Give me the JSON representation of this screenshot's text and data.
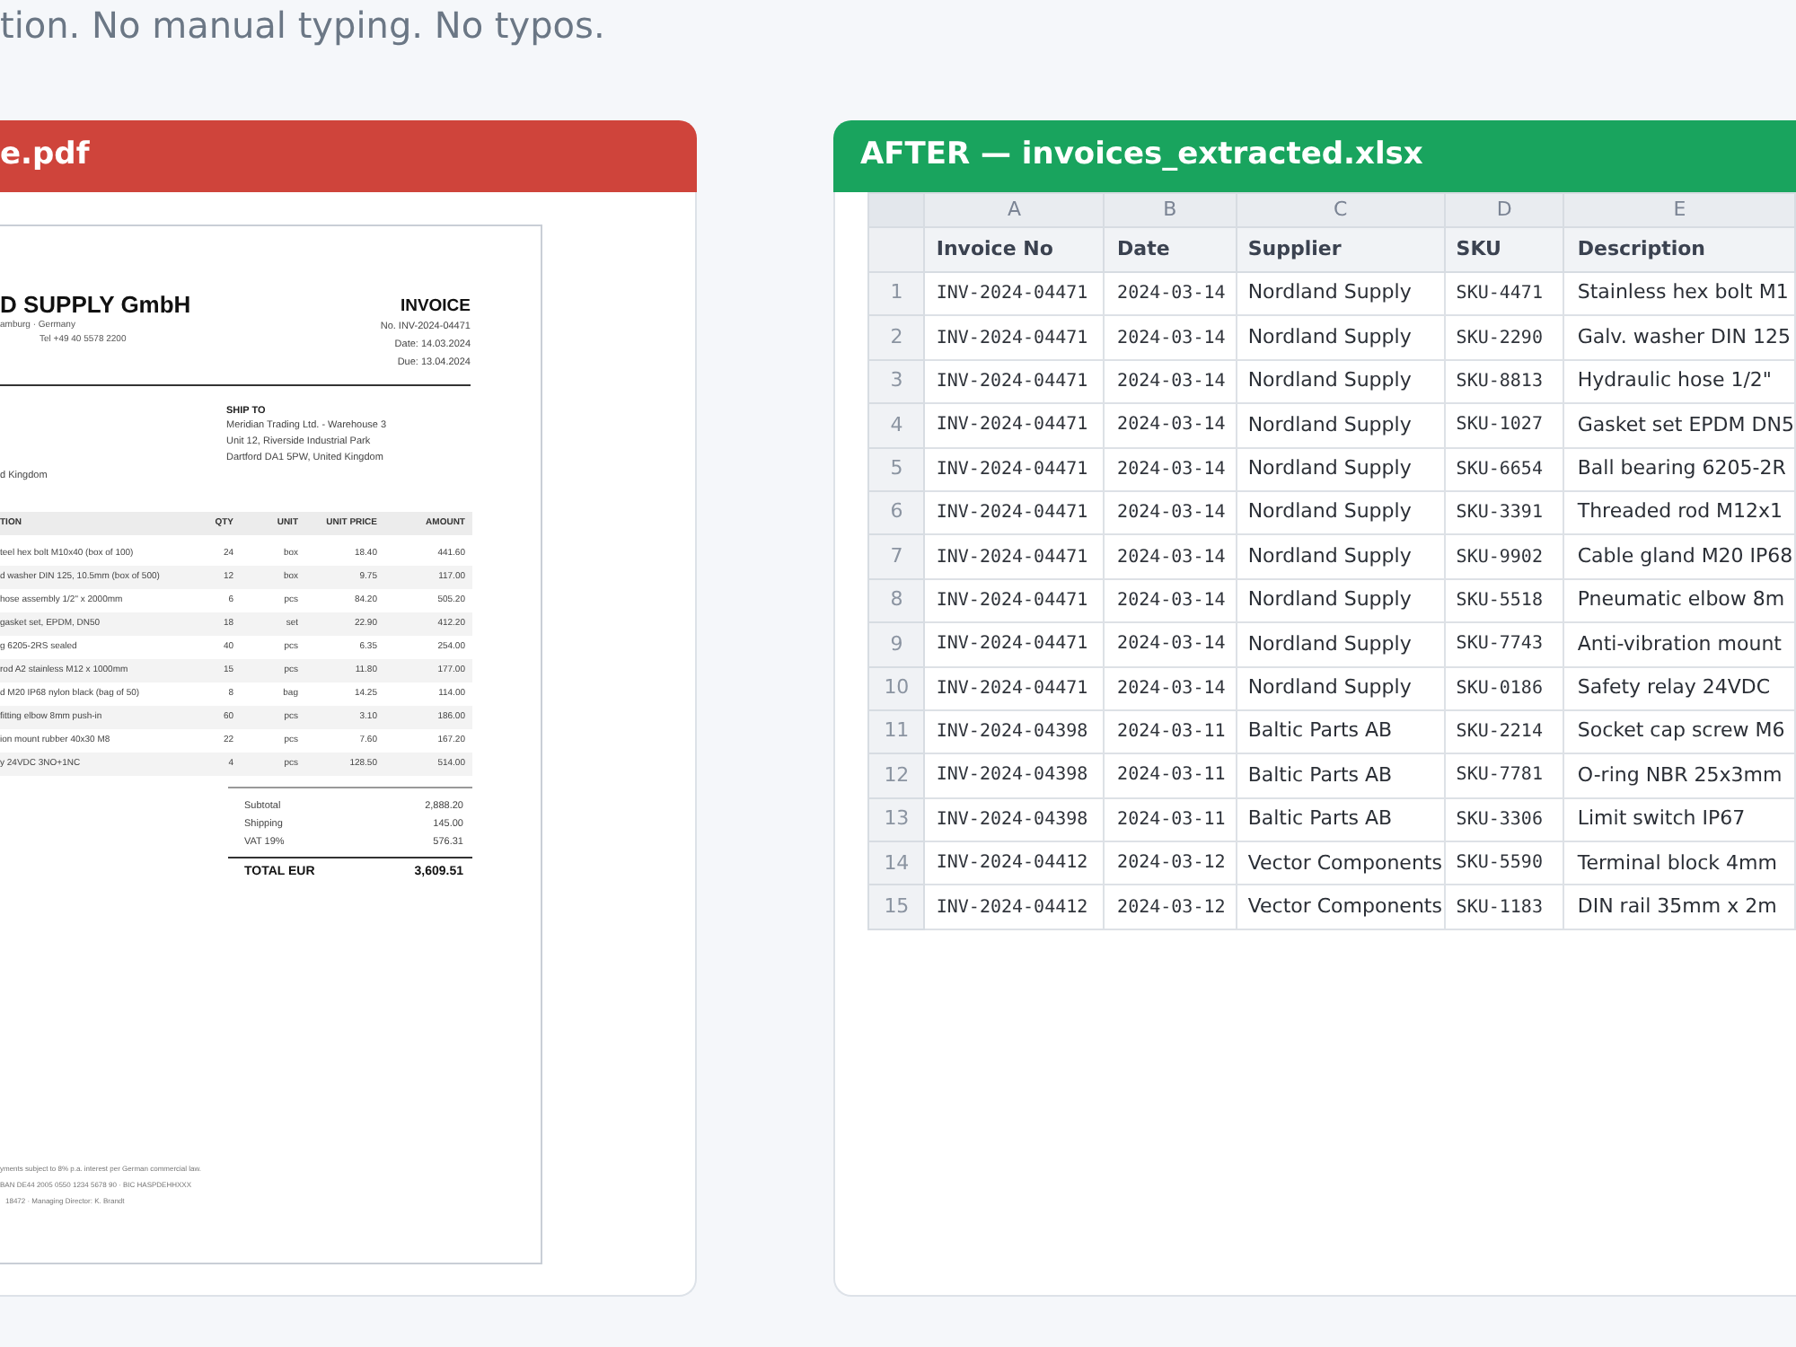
{
  "intro": {
    "text": "tion. No manual typing. No typos."
  },
  "before_panel": {
    "title": "e.pdf",
    "document": {
      "company": "D SUPPLY GmbH",
      "company_lines": [
        "amburg · Germany",
        "Tel +49 40 5578 2200"
      ],
      "doc_title": "INVOICE",
      "meta": [
        "No. INV-2024-04471",
        "Date: 14.03.2024",
        "Due: 13.04.2024"
      ],
      "bill_to_lines": [
        "d Kingdom"
      ],
      "ship_to": {
        "label": "SHIP TO",
        "lines": [
          "Meridian Trading Ltd. - Warehouse 3",
          "Unit 12, Riverside Industrial Park",
          "Dartford DA1 5PW, United Kingdom"
        ]
      },
      "item_columns": [
        "TION",
        "QTY",
        "UNIT",
        "UNIT PRICE",
        "AMOUNT"
      ],
      "items": [
        [
          "teel hex bolt M10x40 (box of 100)",
          "24",
          "box",
          "18.40",
          "441.60"
        ],
        [
          "d washer DIN 125, 10.5mm (box of 500)",
          "12",
          "box",
          "9.75",
          "117.00"
        ],
        [
          "hose assembly 1/2\" x 2000mm",
          "6",
          "pcs",
          "84.20",
          "505.20"
        ],
        [
          "gasket set, EPDM, DN50",
          "18",
          "set",
          "22.90",
          "412.20"
        ],
        [
          "g 6205-2RS sealed",
          "40",
          "pcs",
          "6.35",
          "254.00"
        ],
        [
          "rod A2 stainless M12 x 1000mm",
          "15",
          "pcs",
          "11.80",
          "177.00"
        ],
        [
          "d M20 IP68 nylon black (bag of 50)",
          "8",
          "bag",
          "14.25",
          "114.00"
        ],
        [
          "fitting elbow 8mm push-in",
          "60",
          "pcs",
          "3.10",
          "186.00"
        ],
        [
          "ion mount rubber 40x30 M8",
          "22",
          "pcs",
          "7.60",
          "167.20"
        ],
        [
          "y 24VDC 3NO+1NC",
          "4",
          "pcs",
          "128.50",
          "514.00"
        ]
      ],
      "totals": [
        {
          "label": "Subtotal",
          "value": "2,888.20"
        },
        {
          "label": "Shipping",
          "value": "145.00"
        },
        {
          "label": "VAT 19%",
          "value": "576.31"
        }
      ],
      "grand_total": {
        "label": "TOTAL EUR",
        "value": "3,609.51"
      },
      "footer": [
        "yments subject to 8% p.a. interest per German commercial law.",
        "BAN DE44 2005 0550 1234 5678 90 · BIC HASPDEHHXXX",
        "18472 · Managing Director: K. Brandt"
      ]
    }
  },
  "after_panel": {
    "title": "AFTER — invoices_extracted.xlsx",
    "sheet": {
      "columns": [
        {
          "letter": "A",
          "header": "Invoice No",
          "kind": "code"
        },
        {
          "letter": "B",
          "header": "Date",
          "kind": "code"
        },
        {
          "letter": "C",
          "header": "Supplier",
          "kind": "text"
        },
        {
          "letter": "D",
          "header": "SKU",
          "kind": "code"
        },
        {
          "letter": "E",
          "header": "Description",
          "kind": "text"
        }
      ],
      "rows": [
        {
          "number": "1",
          "cells": [
            "INV-2024-04471",
            "2024-03-14",
            "Nordland Supply",
            "SKU-4471",
            "Stainless hex bolt M1"
          ]
        },
        {
          "number": "2",
          "cells": [
            "INV-2024-04471",
            "2024-03-14",
            "Nordland Supply",
            "SKU-2290",
            "Galv. washer DIN 125"
          ]
        },
        {
          "number": "3",
          "cells": [
            "INV-2024-04471",
            "2024-03-14",
            "Nordland Supply",
            "SKU-8813",
            "Hydraulic hose 1/2\""
          ]
        },
        {
          "number": "4",
          "cells": [
            "INV-2024-04471",
            "2024-03-14",
            "Nordland Supply",
            "SKU-1027",
            "Gasket set EPDM DN5"
          ]
        },
        {
          "number": "5",
          "cells": [
            "INV-2024-04471",
            "2024-03-14",
            "Nordland Supply",
            "SKU-6654",
            "Ball bearing 6205-2R"
          ]
        },
        {
          "number": "6",
          "cells": [
            "INV-2024-04471",
            "2024-03-14",
            "Nordland Supply",
            "SKU-3391",
            "Threaded rod M12x1"
          ]
        },
        {
          "number": "7",
          "cells": [
            "INV-2024-04471",
            "2024-03-14",
            "Nordland Supply",
            "SKU-9902",
            "Cable gland M20 IP68"
          ]
        },
        {
          "number": "8",
          "cells": [
            "INV-2024-04471",
            "2024-03-14",
            "Nordland Supply",
            "SKU-5518",
            "Pneumatic elbow 8m"
          ]
        },
        {
          "number": "9",
          "cells": [
            "INV-2024-04471",
            "2024-03-14",
            "Nordland Supply",
            "SKU-7743",
            "Anti-vibration mount"
          ]
        },
        {
          "number": "10",
          "cells": [
            "INV-2024-04471",
            "2024-03-14",
            "Nordland Supply",
            "SKU-0186",
            "Safety relay 24VDC"
          ]
        },
        {
          "number": "11",
          "cells": [
            "INV-2024-04398",
            "2024-03-11",
            "Baltic Parts AB",
            "SKU-2214",
            "Socket cap screw M6"
          ]
        },
        {
          "number": "12",
          "cells": [
            "INV-2024-04398",
            "2024-03-11",
            "Baltic Parts AB",
            "SKU-7781",
            "O-ring NBR 25x3mm"
          ]
        },
        {
          "number": "13",
          "cells": [
            "INV-2024-04398",
            "2024-03-11",
            "Baltic Parts AB",
            "SKU-3306",
            "Limit switch IP67"
          ]
        },
        {
          "number": "14",
          "cells": [
            "INV-2024-04412",
            "2024-03-12",
            "Vector Components",
            "SKU-5590",
            "Terminal block 4mm"
          ]
        },
        {
          "number": "15",
          "cells": [
            "INV-2024-04412",
            "2024-03-12",
            "Vector Components",
            "SKU-1183",
            "DIN rail 35mm x 2m"
          ]
        }
      ]
    }
  }
}
